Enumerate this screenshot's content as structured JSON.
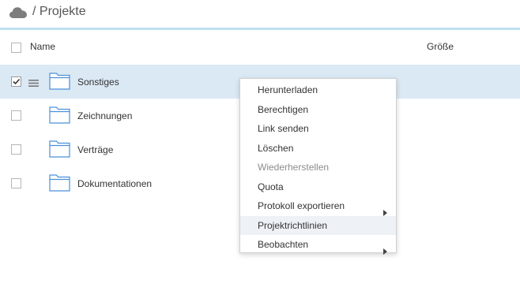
{
  "header": {
    "path": "/ Projekte"
  },
  "columns": {
    "name": "Name",
    "size": "Größe"
  },
  "rows": [
    {
      "label": "Sonstiges",
      "checked": true
    },
    {
      "label": "Zeichnungen",
      "checked": false
    },
    {
      "label": "Verträge",
      "checked": false
    },
    {
      "label": "Dokumentationen",
      "checked": false
    }
  ],
  "context_menu": {
    "items": [
      {
        "label": "Herunterladen"
      },
      {
        "label": "Berechtigen"
      },
      {
        "label": "Link senden"
      },
      {
        "label": "Löschen"
      },
      {
        "label": "Wiederherstellen",
        "disabled": true
      },
      {
        "label": "Quota"
      },
      {
        "label": "Protokoll exportieren",
        "submenu": true
      },
      {
        "label": "Projektrichtlinien",
        "highlighted": true
      },
      {
        "label": "Beobachten",
        "submenu": true
      }
    ]
  },
  "colors": {
    "accent": "#bfe0f2",
    "selected_row": "#dbe9f5",
    "folder_outline": "#4a90d9"
  },
  "icons": {
    "cloud": "cloud-icon",
    "folder": "folder-icon",
    "handle": "hamburger-icon",
    "check": "checkmark-icon",
    "submenu": "caret-right-icon"
  }
}
